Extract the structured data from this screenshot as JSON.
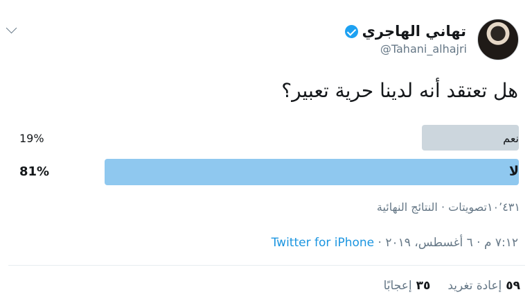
{
  "author": {
    "display_name": "تهاني الهاجري",
    "handle": "@Tahani_alhajri",
    "verified_icon": "verified-badge-icon",
    "avatar": "profile-photo"
  },
  "menu": {
    "icon": "chevron-down-icon"
  },
  "tweet": {
    "question": "هل تعتقد أنه لدينا حرية تعبير؟"
  },
  "poll": {
    "options": [
      {
        "label": "نعم",
        "percent": "19%",
        "share": 0.19,
        "color": "#ccd6dd",
        "winner": false
      },
      {
        "label": "لا",
        "percent": "81%",
        "share": 0.81,
        "color": "#8fc8ef",
        "winner": true
      }
    ],
    "votes_text": "١٠٬٤٣١تصويتات · النتائج النهائية"
  },
  "timestamp": {
    "text": "٧:١٢ م · ٦ أغسطس، ٢٠١٩ · ",
    "source": "Twitter for iPhone"
  },
  "stats": {
    "retweets_count": "٥٩",
    "retweets_label": "إعادة تغريد",
    "likes_count": "٣٥",
    "likes_label": "إعجابًا"
  },
  "colors": {
    "link": "#1b95e0",
    "verified": "#1da1f2",
    "muted_text": "#657786"
  }
}
